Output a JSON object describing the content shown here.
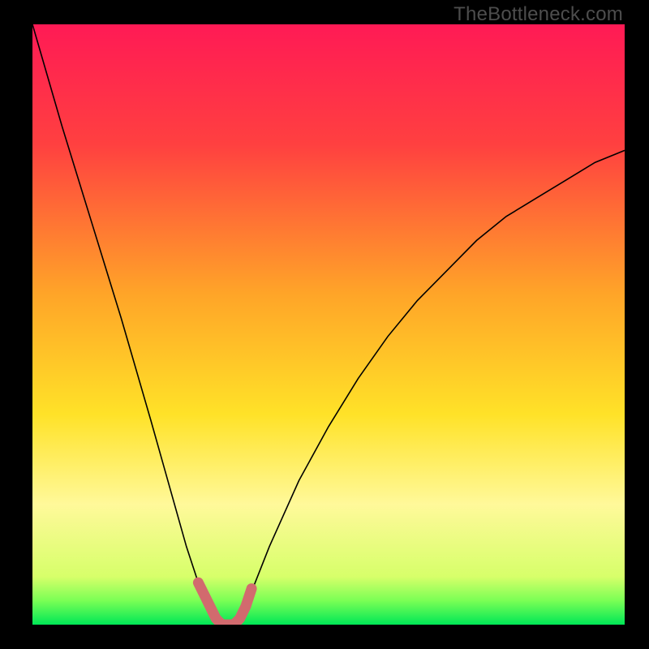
{
  "watermark": "TheBottleneck.com",
  "colors": {
    "black": "#000000",
    "curve": "#000000",
    "highlight": "#d26a6e",
    "bottom_green": "#00e756"
  },
  "chart_data": {
    "type": "line",
    "title": "",
    "xlabel": "",
    "ylabel": "",
    "xlim": [
      0,
      100
    ],
    "ylim": [
      0,
      100
    ],
    "series": [
      {
        "name": "bottleneck-curve",
        "x": [
          0,
          5,
          10,
          15,
          20,
          22,
          24,
          26,
          28,
          30,
          31,
          32,
          33,
          34,
          35,
          36,
          38,
          40,
          45,
          50,
          55,
          60,
          65,
          70,
          75,
          80,
          85,
          90,
          95,
          100
        ],
        "values": [
          100,
          83,
          67,
          51,
          34,
          27,
          20,
          13,
          7,
          3,
          1,
          0,
          0,
          0,
          1,
          3,
          8,
          13,
          24,
          33,
          41,
          48,
          54,
          59,
          64,
          68,
          71,
          74,
          77,
          79
        ]
      },
      {
        "name": "highlight-segment",
        "x": [
          28,
          29,
          30,
          31,
          32,
          33,
          34,
          35,
          36,
          37
        ],
        "values": [
          7,
          5,
          3,
          1,
          0,
          0,
          0,
          1,
          3,
          6
        ]
      }
    ],
    "gradient_stops": [
      {
        "pct": 0,
        "color": "#ff1a55"
      },
      {
        "pct": 20,
        "color": "#ff4040"
      },
      {
        "pct": 45,
        "color": "#ffa528"
      },
      {
        "pct": 65,
        "color": "#ffe228"
      },
      {
        "pct": 80,
        "color": "#fff99a"
      },
      {
        "pct": 92,
        "color": "#d7ff6a"
      },
      {
        "pct": 96,
        "color": "#7aff55"
      },
      {
        "pct": 100,
        "color": "#00e756"
      }
    ]
  }
}
